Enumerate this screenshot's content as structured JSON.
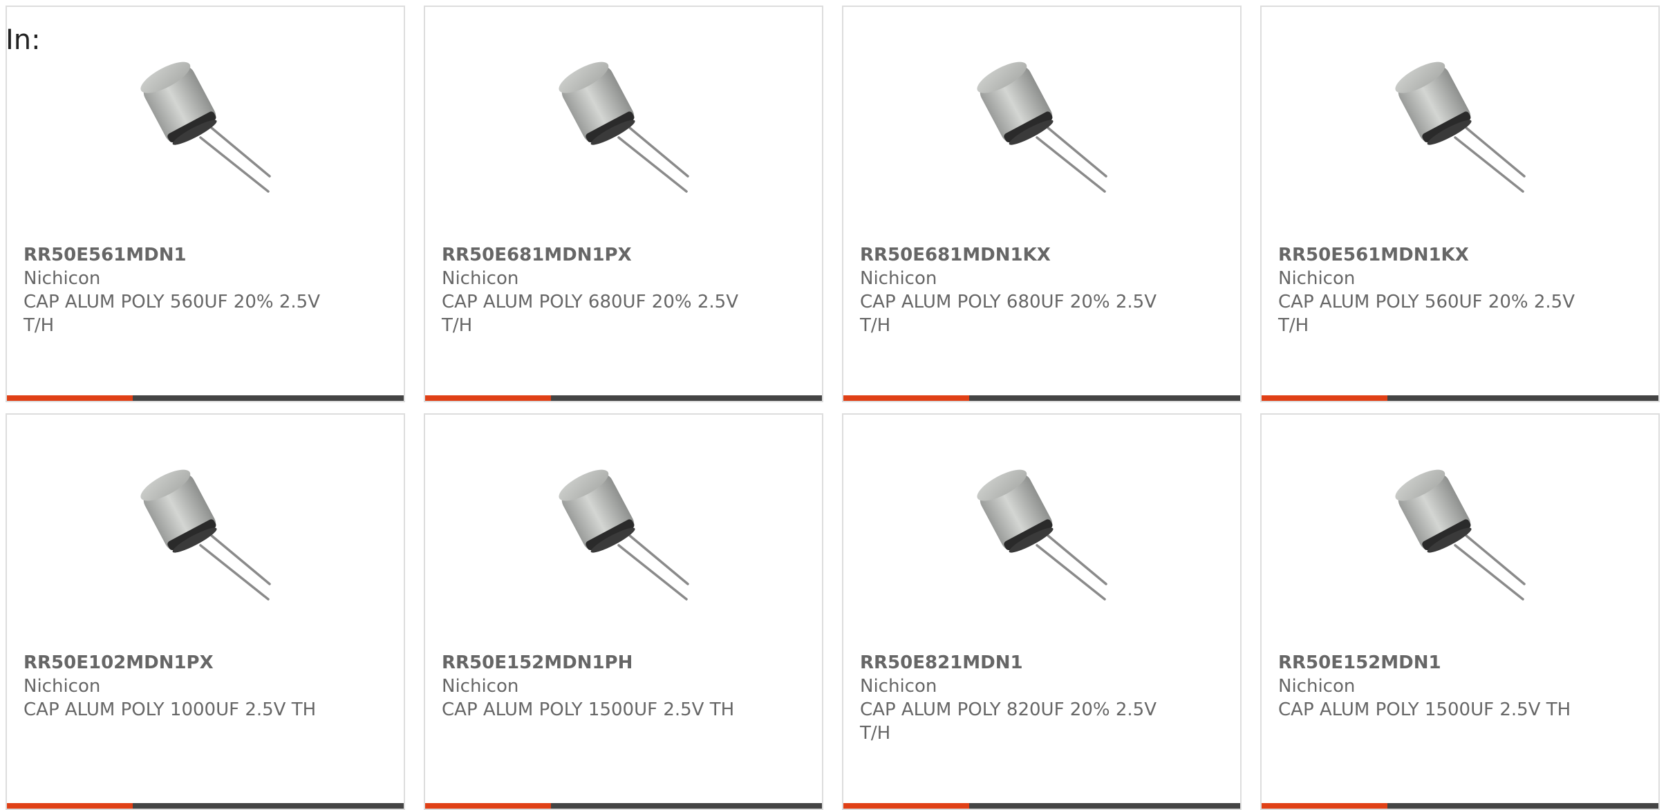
{
  "header": {
    "label": "In:"
  },
  "colors": {
    "accent": "#e04016",
    "bar": "#444444",
    "border": "#dddddd",
    "text": "#666666"
  },
  "products": [
    {
      "part_number": "RR50E561MDN1",
      "manufacturer": "Nichicon",
      "description": "CAP ALUM POLY 560UF 20% 2.5V T/H",
      "image_icon": "radial-capacitor-icon"
    },
    {
      "part_number": "RR50E681MDN1PX",
      "manufacturer": "Nichicon",
      "description": "CAP ALUM POLY 680UF 20% 2.5V T/H",
      "image_icon": "radial-capacitor-icon"
    },
    {
      "part_number": "RR50E681MDN1KX",
      "manufacturer": "Nichicon",
      "description": "CAP ALUM POLY 680UF 20% 2.5V T/H",
      "image_icon": "radial-capacitor-icon"
    },
    {
      "part_number": "RR50E561MDN1KX",
      "manufacturer": "Nichicon",
      "description": "CAP ALUM POLY 560UF 20% 2.5V T/H",
      "image_icon": "radial-capacitor-icon"
    },
    {
      "part_number": "RR50E102MDN1PX",
      "manufacturer": "Nichicon",
      "description": "CAP ALUM POLY 1000UF 2.5V TH",
      "image_icon": "radial-capacitor-icon"
    },
    {
      "part_number": "RR50E152MDN1PH",
      "manufacturer": "Nichicon",
      "description": "CAP ALUM POLY 1500UF 2.5V TH",
      "image_icon": "radial-capacitor-icon"
    },
    {
      "part_number": "RR50E821MDN1",
      "manufacturer": "Nichicon",
      "description": "CAP ALUM POLY 820UF 20% 2.5V T/H",
      "image_icon": "radial-capacitor-icon"
    },
    {
      "part_number": "RR50E152MDN1",
      "manufacturer": "Nichicon",
      "description": "CAP ALUM POLY 1500UF 2.5V TH",
      "image_icon": "radial-capacitor-icon"
    }
  ]
}
